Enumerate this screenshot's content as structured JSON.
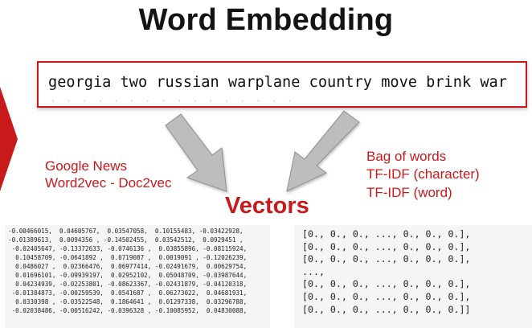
{
  "title": "Word Embedding",
  "sentence": "georgia two russian warplane country move brink war",
  "sentence_shadow": "· · · · · · · · · · · · · · · ·",
  "left_method": {
    "title": "Google News",
    "subtitle": "Word2vec - Doc2vec"
  },
  "right_method": {
    "line1": "Bag of words",
    "line2": "TF-IDF (character)",
    "line3": "TF-IDF   (word)"
  },
  "output_label": "Vectors",
  "left_matrix_rows": [
    "-0.00466015,  0.04605767,  0.03547058,  0.10155483, -0.03422928,",
    "-0.01389613,  0.0094356 , -0.14502455,  0.03542512,  0.0929451 ,",
    " -0.02405647, -0.13372633, -0.0746136 ,  0.03855896, -0.08115924,",
    "  0.10458709, -0.0641892 ,  0.0719087 ,  0.0019091 , -0.12026239,",
    "  0.0486027 ,  0.02366476,  0.06977414, -0.02491679,  0.00629754,",
    "  0.01696101, -0.09939197,  0.02952102,  0.05048709, -0.03987644,",
    "  0.04234939, -0.02253801, -0.08623367, -0.02431879, -0.04120318,",
    " -0.01384873, -0.00259539,  0.0541687 ,  0.06273022,  0.04681931,",
    "  0.0330398 , -0.03522548,  0.1864641 ,  0.01297338,  0.03296788,",
    " -0.02038486, -0.00516242, -0.0396328 , -0.10085952,  0.04830088,"
  ],
  "right_matrix_rows": [
    "[0., 0., 0., ..., 0., 0., 0.],",
    "[0., 0., 0., ..., 0., 0., 0.],",
    "[0., 0., 0., ..., 0., 0., 0.],",
    "...,",
    "[0., 0., 0., ..., 0., 0., 0.],",
    "[0., 0., 0., ..., 0., 0., 0.],",
    "[0., 0., 0., ..., 0., 0., 0.]]"
  ],
  "colors": {
    "accent_red": "#c8191b",
    "arrow_gray": "#b9b9b9",
    "matrix_bg": "#f5f5f5"
  }
}
